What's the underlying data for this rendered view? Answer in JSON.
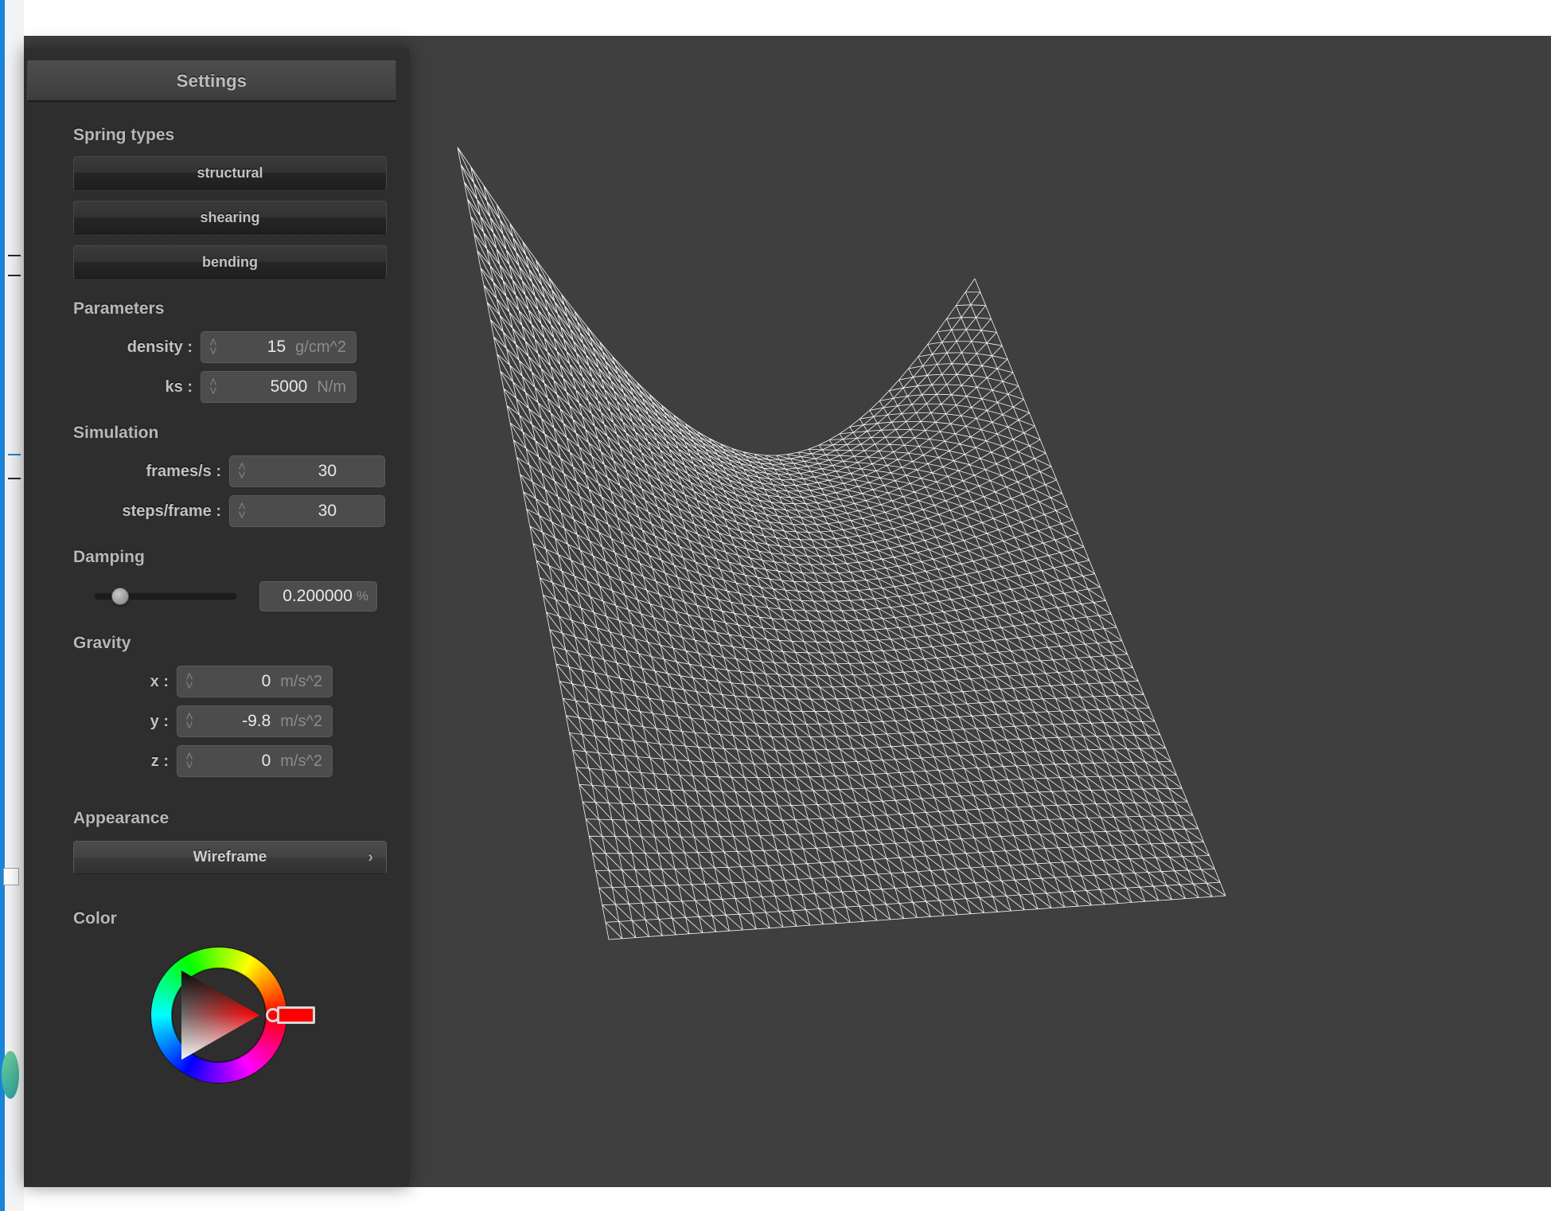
{
  "panel": {
    "title": "Settings",
    "sections": {
      "spring_types": {
        "header": "Spring types",
        "buttons": [
          {
            "label": "structural"
          },
          {
            "label": "shearing"
          },
          {
            "label": "bending"
          }
        ]
      },
      "parameters": {
        "header": "Parameters",
        "fields": [
          {
            "label": "density :",
            "value": "15",
            "unit": "g/cm^2"
          },
          {
            "label": "ks :",
            "value": "5000",
            "unit": "N/m"
          }
        ]
      },
      "simulation": {
        "header": "Simulation",
        "fields": [
          {
            "label": "frames/s :",
            "value": "30",
            "unit": ""
          },
          {
            "label": "steps/frame :",
            "value": "30",
            "unit": ""
          }
        ]
      },
      "damping": {
        "header": "Damping",
        "slider_percent": 18,
        "value": "0.200000",
        "unit": "%"
      },
      "gravity": {
        "header": "Gravity",
        "fields": [
          {
            "label": "x :",
            "value": "0",
            "unit": "m/s^2"
          },
          {
            "label": "y :",
            "value": "-9.8",
            "unit": "m/s^2"
          },
          {
            "label": "z :",
            "value": "0",
            "unit": "m/s^2"
          }
        ]
      },
      "appearance": {
        "header": "Appearance",
        "mode": "Wireframe",
        "chevron": "›"
      },
      "color": {
        "header": "Color",
        "selected_hex": "#ff0000",
        "hue_degrees": 0
      }
    }
  },
  "viewport": {
    "background_hex": "#3f3f3f",
    "mesh_color_hex": "#ffffff",
    "render_mode": "Wireframe"
  },
  "icons": {
    "spin_up": "˄",
    "spin_down": "˅"
  }
}
